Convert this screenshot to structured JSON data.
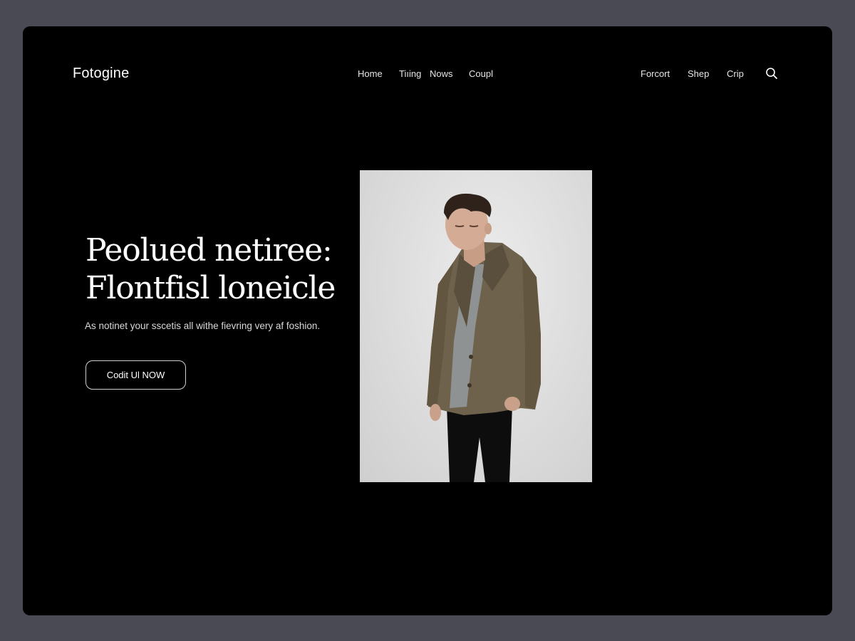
{
  "brand": {
    "logo": "Fotogine"
  },
  "nav": {
    "primary": [
      "Home",
      "Tiıing",
      "Nows",
      "Coupl"
    ],
    "secondary": [
      "Forcort",
      "Shep",
      "Crip"
    ],
    "search_icon": "search-icon"
  },
  "hero": {
    "title_line1": "Peolued netiree:",
    "title_line2": "Flontfisl loneicle",
    "subtitle": "As notinet your sscetis all withe fievring very af foshion.",
    "cta_label": "Codit Ul NOW"
  },
  "colors": {
    "backdrop": "#4a4a54",
    "background": "#000000",
    "text": "#ffffff",
    "photo_background": "#dcdcdc"
  }
}
